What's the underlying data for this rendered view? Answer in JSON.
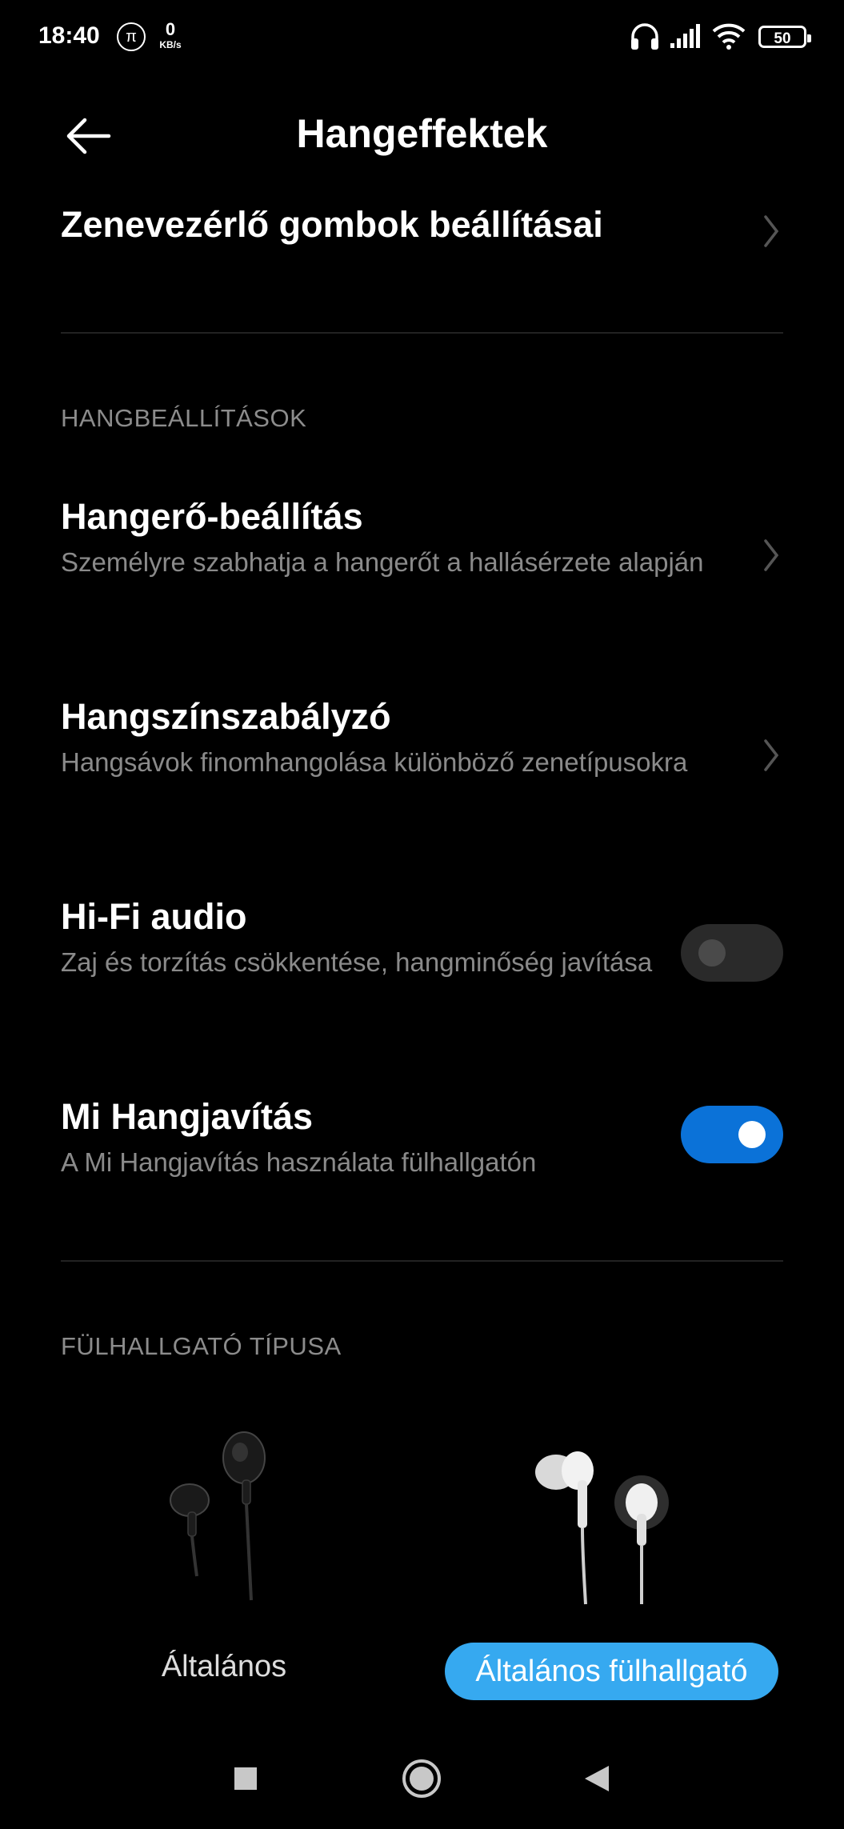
{
  "status_bar": {
    "time": "18:40",
    "pi_symbol": "π",
    "net_speed_value": "0",
    "net_speed_unit": "KB/s",
    "battery": "50",
    "icons": [
      "headphones-icon",
      "signal-icon",
      "wifi-icon",
      "battery-icon"
    ]
  },
  "header": {
    "title": "Hangeffektek",
    "back_icon": "back-arrow-icon"
  },
  "rows": {
    "music_controls": {
      "title": "Zenevezérlő gombok beállításai"
    },
    "volume": {
      "title": "Hangerő-beállítás",
      "subtitle": "Személyre szabhatja a hangerőt a hallásérzete alapján"
    },
    "equalizer": {
      "title": "Hangszínszabályzó",
      "subtitle": "Hangsávok finomhangolása különböző zenetípusokra"
    },
    "hifi": {
      "title": "Hi-Fi audio",
      "subtitle": "Zaj és torzítás csökkentése, hangminőség javítása",
      "enabled": false
    },
    "mi_sound": {
      "title": "Mi Hangjavítás",
      "subtitle": "A Mi Hangjavítás használata fülhallgatón",
      "enabled": true
    }
  },
  "sections": {
    "sound_settings": "HANGBEÁLLÍTÁSOK",
    "headphone_type": "FÜLHALLGATÓ TÍPUSA"
  },
  "headphone_types": [
    {
      "label": "Általános",
      "selected": false,
      "icon": "black-earbuds-icon"
    },
    {
      "label": "Általános fülhallgató",
      "selected": true,
      "icon": "white-in-ear-earphones-icon"
    }
  ],
  "colors": {
    "accent": "#0b72d8",
    "chip_active": "#36a9f0",
    "subtitle": "#8a8a8a"
  },
  "nav_bar": [
    "recents-square-icon",
    "home-circle-icon",
    "back-triangle-icon"
  ]
}
